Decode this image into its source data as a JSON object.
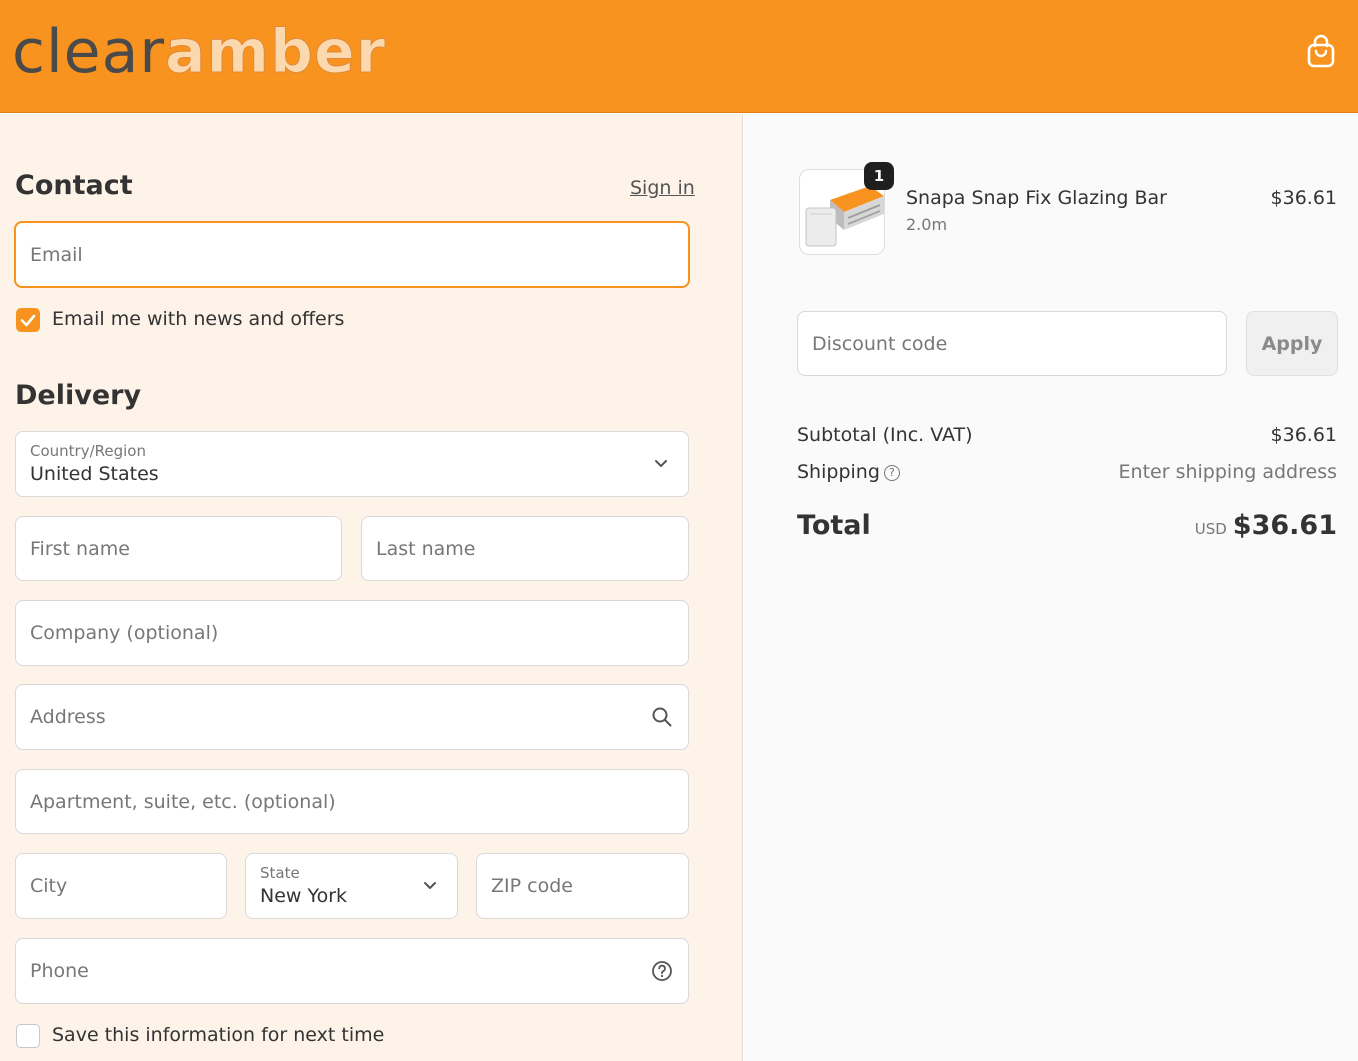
{
  "header": {
    "logo_part1": "clear",
    "logo_part2": "amber",
    "cart_icon": "shopping-bag-icon",
    "brand_color": "#f7931e"
  },
  "contact": {
    "title": "Contact",
    "sign_in": "Sign in",
    "email_placeholder": "Email",
    "newsletter_label": "Email me with news and offers",
    "newsletter_checked": true
  },
  "delivery": {
    "title": "Delivery",
    "country_label": "Country/Region",
    "country_value": "United States",
    "first_name_placeholder": "First name",
    "last_name_placeholder": "Last name",
    "company_placeholder": "Company (optional)",
    "address_placeholder": "Address",
    "apartment_placeholder": "Apartment, suite, etc. (optional)",
    "city_placeholder": "City",
    "state_label": "State",
    "state_value": "New York",
    "zip_placeholder": "ZIP code",
    "phone_placeholder": "Phone",
    "save_info_label": "Save this information for next time",
    "save_info_checked": false
  },
  "summary": {
    "product": {
      "quantity": "1",
      "name": "Snapa Snap Fix Glazing Bar",
      "variant": "2.0m",
      "price": "$36.61"
    },
    "discount_placeholder": "Discount code",
    "apply_label": "Apply",
    "subtotal_label": "Subtotal (Inc. VAT)",
    "subtotal_value": "$36.61",
    "shipping_label": "Shipping",
    "shipping_value": "Enter shipping address",
    "total_label": "Total",
    "total_currency": "USD",
    "total_value": "$36.61"
  }
}
